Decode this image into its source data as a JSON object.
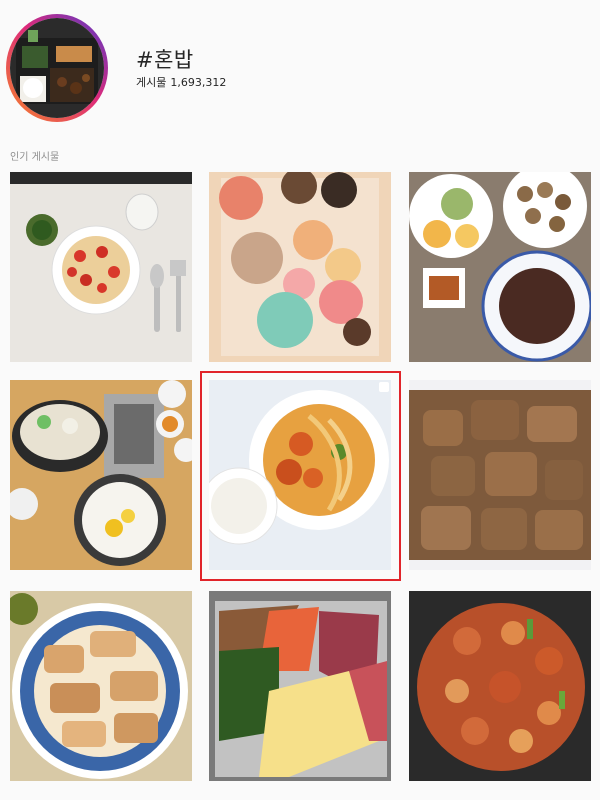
{
  "hashtag": {
    "title": "#혼밥",
    "posts_label": "게시물",
    "posts_count": "1,693,312"
  },
  "sections": {
    "popular_label": "인기 게시물"
  },
  "colors": {
    "highlight": "#e1242a",
    "ring_start": "#f58529",
    "ring_end": "#515bd4"
  },
  "grid": {
    "selected_index": 4,
    "posts": [
      {
        "subject": "tomato-onion-dish-with-spoon-fork"
      },
      {
        "subject": "macarons-box"
      },
      {
        "subject": "grapes-mushrooms-beef-plates"
      },
      {
        "subject": "stew-rice-bowl"
      },
      {
        "subject": "noodles-chicken-and-rice"
      },
      {
        "subject": "grilled-pork"
      },
      {
        "subject": "pork-belly-plate"
      },
      {
        "subject": "bibimbap-ingredients-tray"
      },
      {
        "subject": "spicy-stir-fried-pork"
      }
    ]
  }
}
